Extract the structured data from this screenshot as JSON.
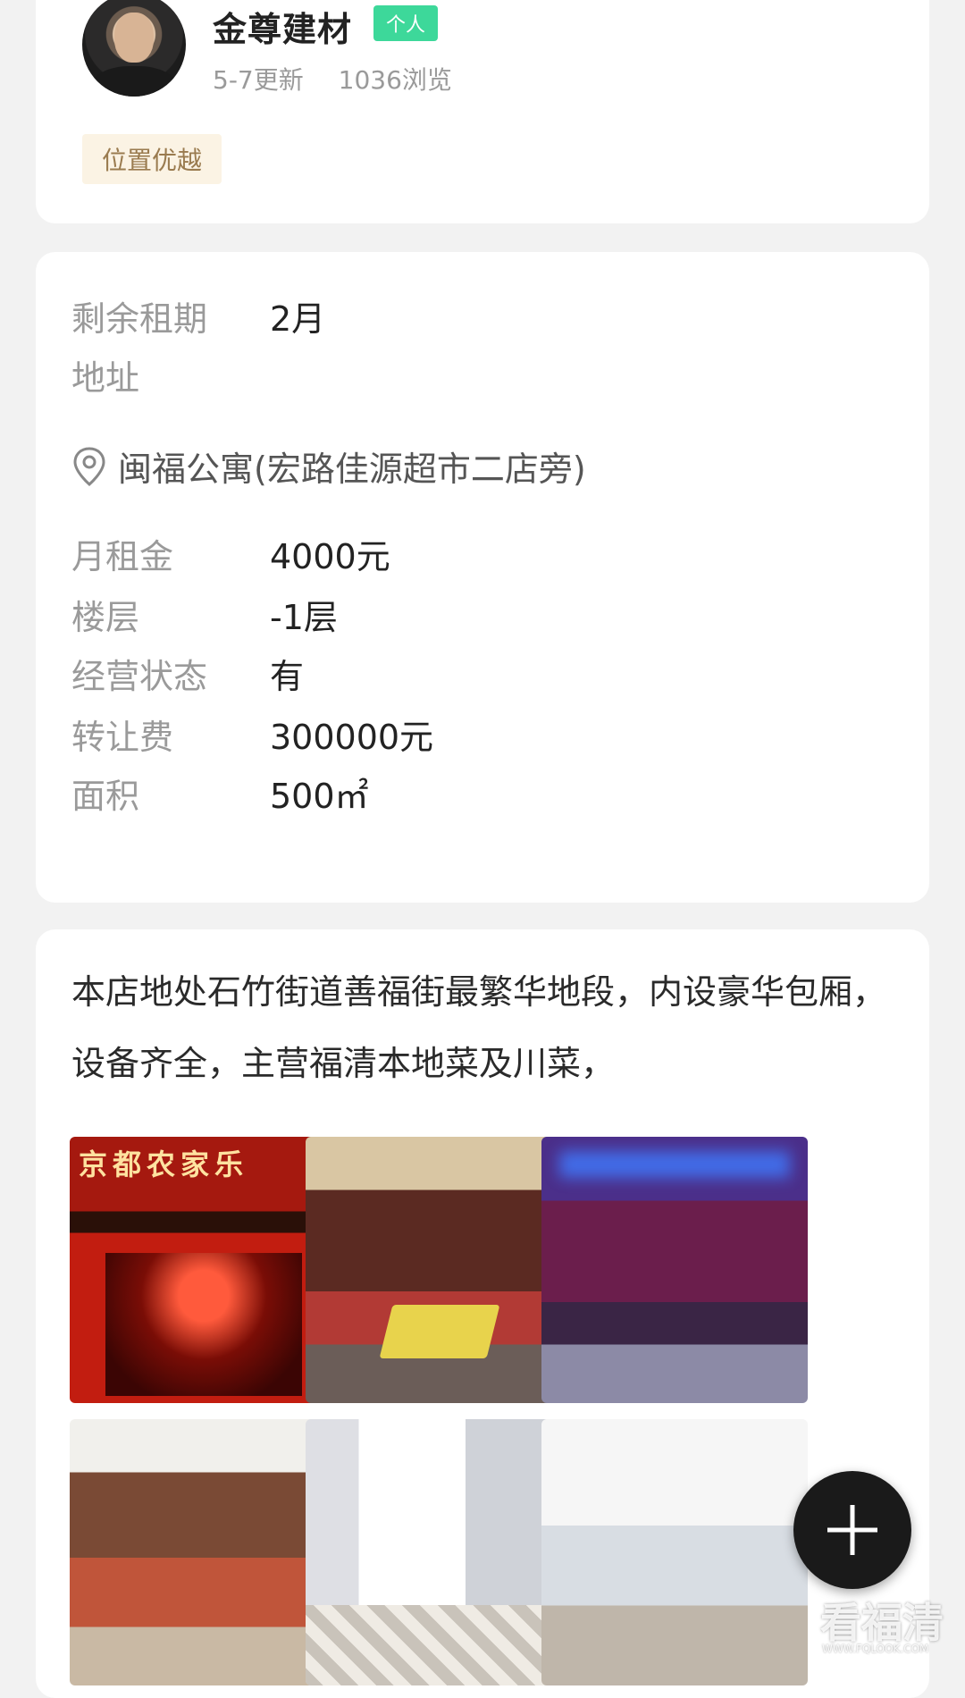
{
  "publisher": {
    "name": "金尊建材",
    "tag": "个人",
    "updated": "5-7更新",
    "views": "1036浏览",
    "feature": "位置优越",
    "avatar_icon": "avatar-photo"
  },
  "details": {
    "remaining_lease": {
      "label": "剩余租期",
      "value": "2月"
    },
    "address": {
      "label": "地址",
      "value": "闽福公寓(宏路佳源超市二店旁)",
      "icon": "location-pin-icon"
    },
    "monthly_rent": {
      "label": "月租金",
      "value": "4000元"
    },
    "floor": {
      "label": "楼层",
      "value": "-1层"
    },
    "operating_status": {
      "label": "经营状态",
      "value": "有"
    },
    "transfer_fee": {
      "label": "转让费",
      "value": "300000元"
    },
    "area": {
      "label": "面积",
      "value": "500㎡"
    }
  },
  "description": "本店地处石竹街道善福街最繁华地段，内设豪华包厢，设备齐全，主营福清本地菜及川菜，",
  "photos": {
    "sign_text": "京都农家乐"
  },
  "fab": {
    "icon": "plus-icon"
  },
  "watermark": {
    "text": "看福清",
    "sub": "WWW.FQLOOK.COM"
  },
  "colors": {
    "tag_bg": "#3dd89a",
    "badge_bg": "#fbf3e4",
    "badge_text": "#9a7b4f",
    "fab_bg": "#1a1a1a"
  }
}
